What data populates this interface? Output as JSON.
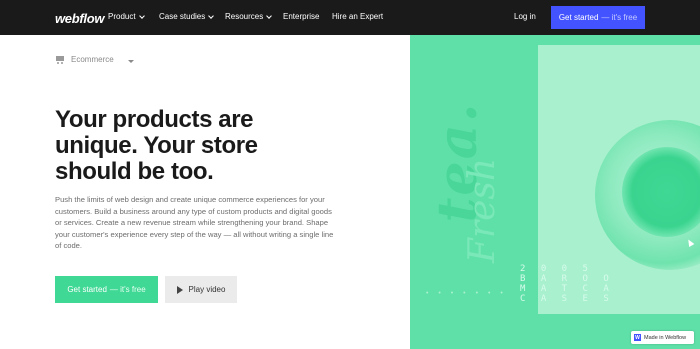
{
  "nav": {
    "logo": "webflow",
    "items": [
      {
        "label": "Product",
        "dropdown": true
      },
      {
        "label": "Case studies",
        "dropdown": true
      },
      {
        "label": "Resources",
        "dropdown": true
      },
      {
        "label": "Enterprise",
        "dropdown": false
      },
      {
        "label": "Hire an Expert",
        "dropdown": false
      }
    ],
    "login": "Log in",
    "cta_main": "Get started",
    "cta_sub": "— it's free"
  },
  "breadcrumb": {
    "icon": "cart-icon",
    "label": "Ecommerce"
  },
  "hero": {
    "headline_lines": [
      "Your products are",
      "unique. Your store",
      "should be too."
    ],
    "body": "Push the limits of web design and create unique commerce experiences for your customers. Build a business around any type of custom products and digital goods or services. Create a new revenue stream while strengthening your brand. Shape your customer's experience every step of the way — all without writing a single line of code.",
    "primary_main": "Get started",
    "primary_sub": "— it's free",
    "secondary": "Play video"
  },
  "image": {
    "word_big": "tea.",
    "word_script": "Fresh",
    "lettering": "2 0 0 5\nB A R O O\nM A T C A\nC A S E S"
  },
  "badge": {
    "label": "Made in Webflow",
    "logo_letter": "W"
  },
  "colors": {
    "nav_bg": "#1a1a1a",
    "accent_blue": "#4353ff",
    "accent_green": "#3fd894",
    "panel_green": "#5fe0a8"
  }
}
